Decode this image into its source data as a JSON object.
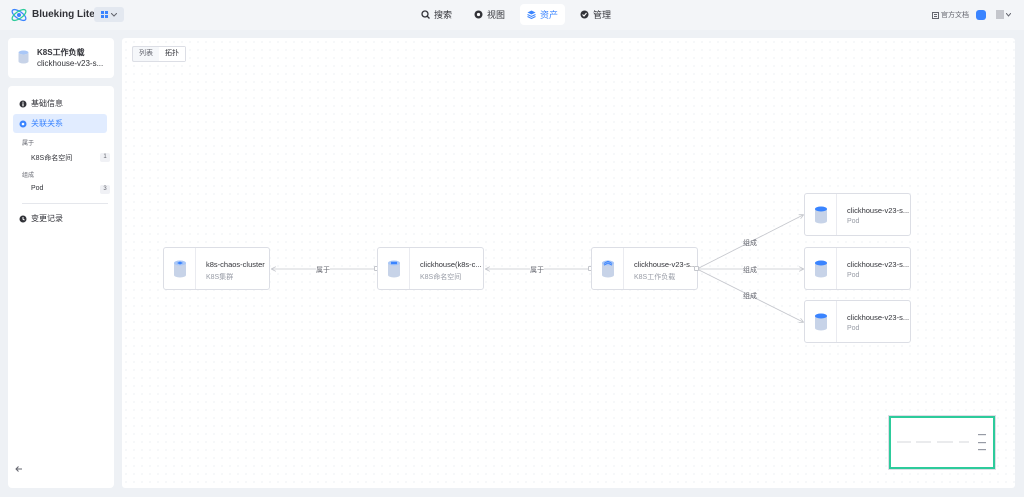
{
  "header": {
    "app_title": "Blueking Lite",
    "nav": [
      {
        "label": "搜索",
        "icon": "search-icon"
      },
      {
        "label": "视图",
        "icon": "view-icon"
      },
      {
        "label": "资产",
        "icon": "layers-icon",
        "active": true
      },
      {
        "label": "管理",
        "icon": "manage-icon"
      }
    ],
    "doc_link": "官方文档"
  },
  "object": {
    "title": "K8S工作负载",
    "instance": "clickhouse-v23-s..."
  },
  "sidebar": {
    "basic_info": "基础信息",
    "relations": "关联关系",
    "group_belongs": "属于",
    "namespace_item": "K8S命名空间",
    "namespace_count": "1",
    "group_composed": "组成",
    "pod_item": "Pod",
    "pod_count": "3",
    "change_log": "变更记录"
  },
  "main": {
    "toggle_list": "列表",
    "toggle_topology": "拓扑"
  },
  "topology": {
    "nodes": [
      {
        "title": "k8s-chaos-cluster",
        "type": "K8S集群"
      },
      {
        "title": "clickhouse(k8s-c...",
        "type": "K8S命名空间"
      },
      {
        "title": "clickhouse-v23-s...",
        "type": "K8S工作负载"
      },
      {
        "title": "clickhouse-v23-s...",
        "type": "Pod"
      },
      {
        "title": "clickhouse-v23-s...",
        "type": "Pod"
      },
      {
        "title": "clickhouse-v23-s...",
        "type": "Pod"
      }
    ],
    "edge_labels": [
      "属于",
      "属于",
      "组成",
      "组成",
      "组成"
    ]
  },
  "colors": {
    "accent": "#3a84ff",
    "minimap_frame": "#2dcb9b"
  }
}
